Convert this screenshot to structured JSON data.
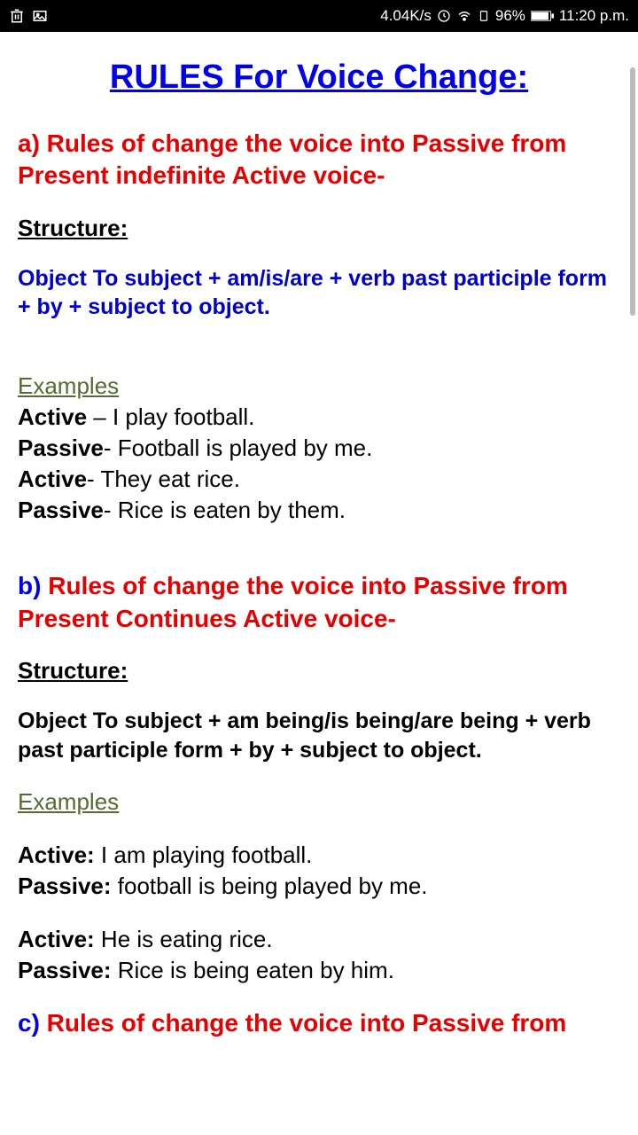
{
  "statusBar": {
    "speed": "4.04K/s",
    "battery": "96%",
    "time": "11:20 p.m."
  },
  "title": "RULES For Voice Change: ",
  "sectionA": {
    "letter": "a)",
    "text1": " Rules of change the voice into Passive from ",
    "text2": "Present indefinite",
    "text3": " Active voice-",
    "structLabel": "Structure: ",
    "formula": "Object To subject + am/is/are + verb past participle form + by + subject to object.",
    "examplesLabel": "Examples",
    "ex1a": "Active",
    "ex1b": " – I play football.",
    "ex2a": "Passive",
    "ex2b": "- Football is played by me.",
    "ex3a": "Active",
    "ex3b": "- They eat rice.",
    "ex4a": "Passive",
    "ex4b": "- Rice is eaten by them."
  },
  "sectionB": {
    "letter": "b)",
    "text1": " Rules of change the voice into Passive from ",
    "text2": "Present Continues",
    "text3": " Active voice-",
    "structLabel": "Structure: ",
    "formula": "Object To subject + am being/is being/are being + verb past participle form + by + subject to object.",
    "examplesLabel": "Examples",
    "p1aLabel": "Active:",
    "p1a": " I am playing football.",
    "p1bLabel": "Passive:",
    "p1b": " football is being played by me.",
    "p2aLabel": "Active:",
    "p2a": " He is eating rice.",
    "p2bLabel": "Passive:",
    "p2b": " Rice is being eaten by him."
  },
  "sectionC": {
    "letter": "c)",
    "text": " Rules of change the voice into Passive from"
  }
}
